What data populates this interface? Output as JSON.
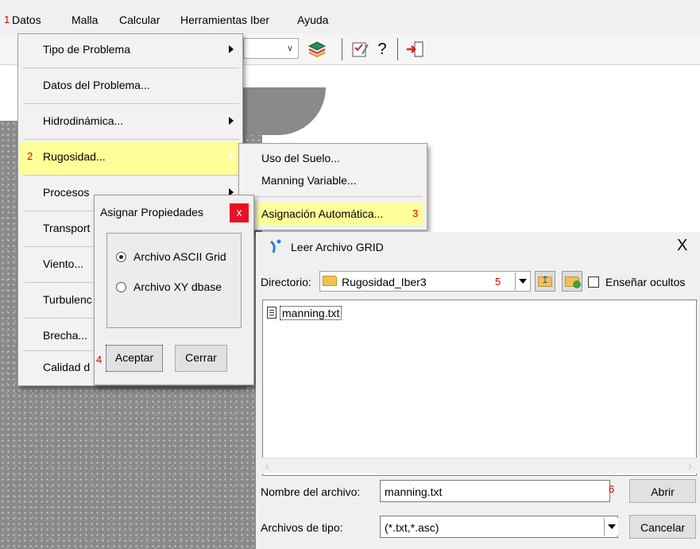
{
  "menubar": {
    "items": [
      "Datos",
      "Malla",
      "Calcular",
      "Herramientas Iber",
      "Ayuda"
    ]
  },
  "step_markers": {
    "s1": "1",
    "s2": "2",
    "s3": "3",
    "s4": "4",
    "s5": "5",
    "s6": "6"
  },
  "datos_menu": {
    "items": [
      {
        "label": "Tipo de Problema",
        "submenu": true
      },
      {
        "label": "Datos del Problema...",
        "submenu": false
      },
      {
        "label": "Hidrodinámica...",
        "submenu": true
      },
      {
        "label": "Rugosidad...",
        "submenu": true,
        "highlighted": true
      },
      {
        "label": "Procesos",
        "submenu": true
      },
      {
        "label": "Transport",
        "submenu": false
      },
      {
        "label": "Viento...",
        "submenu": false
      },
      {
        "label": "Turbulenc",
        "submenu": false
      },
      {
        "label": "Brecha...",
        "submenu": false
      },
      {
        "label": "Calidad d",
        "submenu": false
      }
    ]
  },
  "rugosidad_submenu": {
    "items": [
      "Uso del Suelo...",
      "Manning Variable...",
      "Asignación Automática..."
    ]
  },
  "asignar_dialog": {
    "title": "Asignar Propiedades",
    "close": "x",
    "option_ascii": "Archivo ASCII Grid",
    "option_xy": "Archivo XY dbase",
    "accept": "Aceptar",
    "close_button": "Cerrar"
  },
  "file_dialog": {
    "title": "Leer Archivo GRID",
    "close_glyph": "X",
    "directory_label": "Directorio:",
    "directory_value": "Rugosidad_Iber3",
    "show_hidden": "Enseñar ocultos",
    "files": [
      "manning.txt"
    ],
    "filename_label": "Nombre del archivo:",
    "filename_value": "manning.txt",
    "open_button": "Abrir",
    "filetype_label": "Archivos de tipo:",
    "filetype_value": "(*.txt,*.asc)",
    "cancel_button": "Cancelar"
  },
  "colors": {
    "highlight": "#ffff99",
    "marker_red": "#e00000",
    "close_red": "#e81123",
    "folder_yellow": "#f2c152"
  },
  "icons": [
    "layers-icon",
    "checklist-icon",
    "help-question-icon",
    "exit-icon",
    "dropdown-arrow-icon",
    "folder-up-icon",
    "new-folder-icon",
    "text-file-icon",
    "iber-app-icon"
  ]
}
